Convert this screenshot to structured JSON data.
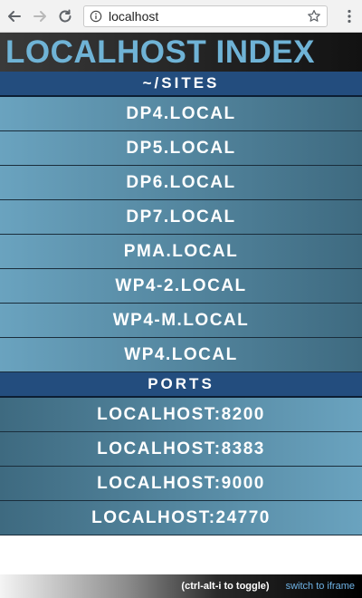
{
  "browser": {
    "url": "localhost",
    "icons": [
      "back-arrow-icon",
      "forward-arrow-icon",
      "reload-icon",
      "info-icon",
      "star-icon",
      "kebab-menu-icon"
    ]
  },
  "header": {
    "title": "LOCALHOST INDEX",
    "title_color": "#6fb3d6"
  },
  "sites": {
    "heading": "~/SITES",
    "items": [
      {
        "label": "DP4.LOCAL"
      },
      {
        "label": "DP5.LOCAL"
      },
      {
        "label": "DP6.LOCAL"
      },
      {
        "label": "DP7.LOCAL"
      },
      {
        "label": "PMA.LOCAL"
      },
      {
        "label": "WP4-2.LOCAL"
      },
      {
        "label": "WP4-M.LOCAL"
      },
      {
        "label": "WP4.LOCAL"
      }
    ]
  },
  "ports": {
    "heading": "PORTS",
    "items": [
      {
        "label": "LOCALHOST:8200"
      },
      {
        "label": "LOCALHOST:8383"
      },
      {
        "label": "LOCALHOST:9000"
      },
      {
        "label": "LOCALHOST:24770"
      }
    ]
  },
  "footer": {
    "toggle_hint": "(ctrl-alt-i to toggle)",
    "iframe_link": "switch to iframe",
    "link_color": "#6fb3e6"
  }
}
